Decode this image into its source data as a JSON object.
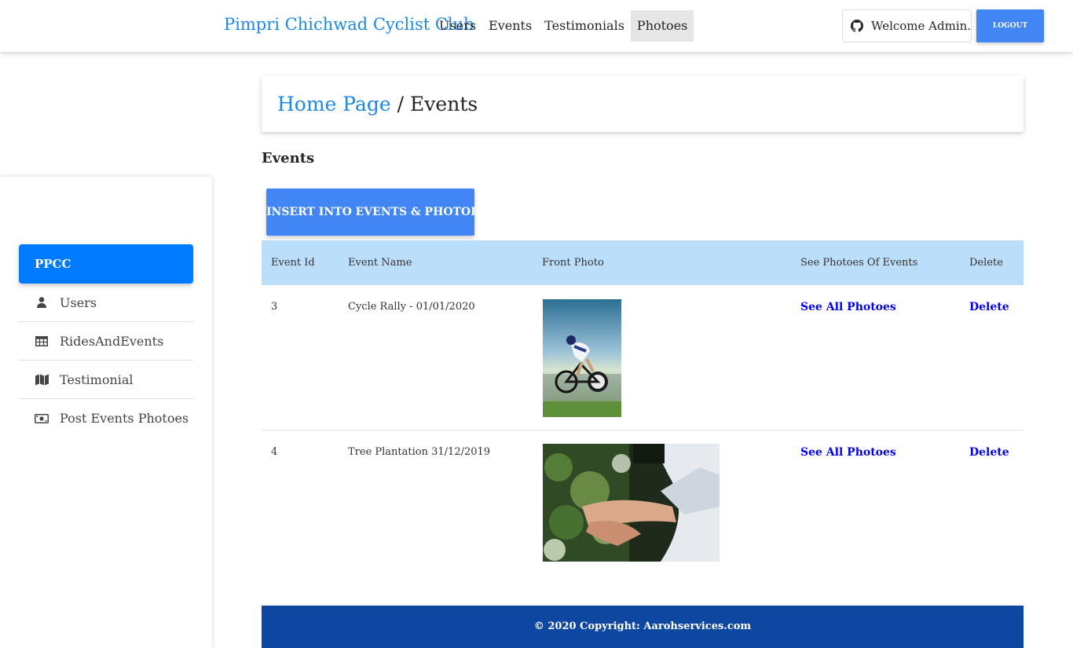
{
  "navbar": {
    "brand": "Pimpri Chichwad Cyclist Club",
    "links": [
      "Users",
      "Events",
      "Testimonials",
      "Photoes"
    ],
    "active_link": "Photoes",
    "welcome": "Welcome Admin..",
    "welcome_icon": "github-icon",
    "logout": "LOGOUT"
  },
  "sidebar": {
    "brand": "PPCC",
    "items": [
      {
        "label": "Users",
        "icon": "user-icon"
      },
      {
        "label": "RidesAndEvents",
        "icon": "table-icon"
      },
      {
        "label": "Testimonial",
        "icon": "map-icon"
      },
      {
        "label": "Post Events Photoes",
        "icon": "money-bill-icon"
      }
    ]
  },
  "breadcrumb": {
    "home": "Home Page",
    "separator": "/",
    "current": "Events"
  },
  "section": {
    "title": "Events",
    "insert_button": "INSERT INTO EVENTS & PHOTOES"
  },
  "table": {
    "headers": [
      "Event Id",
      "Event Name",
      "Front Photo",
      "See Photoes Of Events",
      "Delete"
    ],
    "rows": [
      {
        "id": "3",
        "name": "Cycle Rally - 01/01/2020",
        "see_all": "See All Photoes",
        "delete": "Delete"
      },
      {
        "id": "4",
        "name": "Tree Plantation 31/12/2019",
        "see_all": "See All Photoes",
        "delete": "Delete"
      }
    ]
  },
  "footer": {
    "text": "© 2020 Copyright: Aarohservices.com"
  },
  "colors": {
    "brand_blue": "#1e88e5",
    "button_blue": "#4285f4",
    "sidebar_active": "#007bff",
    "table_header": "#bbdefb",
    "footer_bg": "#0d47a1",
    "link": "#0000ee"
  }
}
